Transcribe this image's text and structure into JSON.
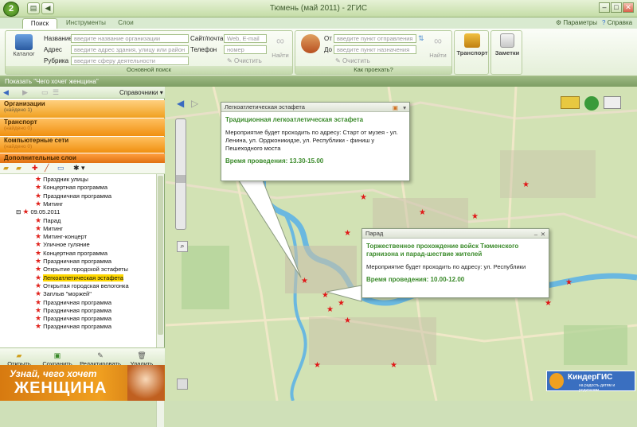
{
  "app": {
    "title": "Тюмень (май 2011) - 2ГИС"
  },
  "tabs": [
    {
      "label": "Поиск"
    },
    {
      "label": "Инструменты"
    },
    {
      "label": "Слои"
    }
  ],
  "top_links": {
    "params": "Параметры",
    "help": "Справка"
  },
  "search": {
    "catalog_label": "Каталог",
    "name_label": "Название",
    "name_placeholder": "введите название организации",
    "address_label": "Адрес",
    "address_placeholder": "введите адрес здания, улицу или район",
    "rubric_label": "Рубрика",
    "rubric_placeholder": "введите сферу деятельности",
    "site_label": "Сайт/почта",
    "site_placeholder": "Web, E-mail",
    "phone_label": "Телефон",
    "phone_placeholder": "номер",
    "clear_label": "Очистить",
    "find_label": "Найти",
    "group_label": "Основной поиск"
  },
  "route": {
    "from_label": "От",
    "from_placeholder": "введите пункт отправления",
    "to_label": "До",
    "to_placeholder": "введите пункт назначения",
    "clear_label": "Очистить",
    "find_label": "Найти",
    "group_label": "Как проехать?"
  },
  "transport_label": "Транспорт",
  "notes_label": "Заметки",
  "show_bar": "Показать \"Чего хочет женщина\"",
  "left_toolbar": {
    "dir_label": "Справочники"
  },
  "categories": [
    {
      "name": "Организации",
      "sub": "(найдено 1)"
    },
    {
      "name": "Транспорт",
      "sub": "(найдено 0)"
    },
    {
      "name": "Компьютерные сети",
      "sub": "(найдено 0)"
    },
    {
      "name": "Дополнительные слои",
      "sub": ""
    }
  ],
  "tree": [
    {
      "label": "Праздник улицы",
      "level": 2
    },
    {
      "label": "Концертная программа",
      "level": 2
    },
    {
      "label": "Праздничная программа",
      "level": 2
    },
    {
      "label": "Митинг",
      "level": 2
    },
    {
      "label": "09.05.2011",
      "level": 1
    },
    {
      "label": "Парад",
      "level": 2
    },
    {
      "label": "Митинг",
      "level": 2
    },
    {
      "label": "Митинг-концерт",
      "level": 2
    },
    {
      "label": "Уличное гуляние",
      "level": 2
    },
    {
      "label": "Концертная программа",
      "level": 2
    },
    {
      "label": "Праздничная программа",
      "level": 2
    },
    {
      "label": "Открытие городской эстафеты",
      "level": 2
    },
    {
      "label": "Легкоатлетическая эстафета",
      "level": 2,
      "selected": true
    },
    {
      "label": "Открытая городская велогонка",
      "level": 2
    },
    {
      "label": "Заплыв \"моржей\"",
      "level": 2
    },
    {
      "label": "Праздничная программа",
      "level": 2
    },
    {
      "label": "Праздничная программа",
      "level": 2
    },
    {
      "label": "Праздничная программа",
      "level": 2
    },
    {
      "label": "Праздничная программа",
      "level": 2
    }
  ],
  "bottom_buttons": [
    {
      "label": "Открыть"
    },
    {
      "label": "Сохранить"
    },
    {
      "label": "Редактировать"
    },
    {
      "label": "Удалить"
    }
  ],
  "ad": {
    "line1": "Узнай, чего хочет",
    "line2": "ЖЕНЩИНА"
  },
  "popup1": {
    "header": "Легкоатлетическая эстафета",
    "title": "Традиционная легкоатлетическая эстафета",
    "desc": "Мероприятие будет проходить по адресу: Старт от музея - ул. Ленина, ул. Орджоникидзе, ул. Республики - финиш у Пешеходного моста",
    "time": "Время проведения: 13.30-15.00"
  },
  "popup2": {
    "header": "Парад",
    "title": "Торжественное прохождение войск Тюменского гарнизона и парад-шествие жителей",
    "desc": "Мероприятие будет проходить по адресу: ул. Республики",
    "time": "Время проведения: 10.00-12.00"
  },
  "kinder": {
    "label": "КиндерГИС",
    "sub": "на радость детям и родителям"
  },
  "colors": {
    "accent_green": "#3a8a2a",
    "marker_red": "#e01818",
    "category_orange": "#f0a020"
  }
}
